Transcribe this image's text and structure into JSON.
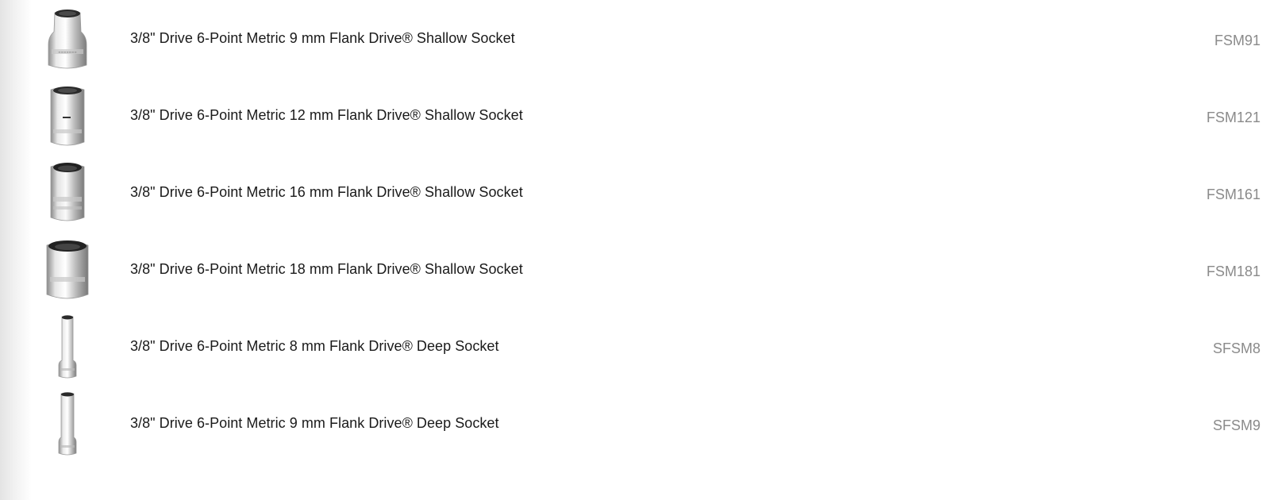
{
  "products": [
    {
      "name": "3/8\" Drive 6-Point Metric 9 mm Flank Drive® Shallow Socket",
      "sku": "FSM91",
      "image": "shallow-socket-icon"
    },
    {
      "name": "3/8\" Drive 6-Point Metric 12 mm Flank Drive® Shallow Socket",
      "sku": "FSM121",
      "image": "shallow-socket-icon"
    },
    {
      "name": "3/8\" Drive 6-Point Metric 16 mm Flank Drive® Shallow Socket",
      "sku": "FSM161",
      "image": "shallow-socket-icon"
    },
    {
      "name": "3/8\" Drive 6-Point Metric 18 mm Flank Drive® Shallow Socket",
      "sku": "FSM181",
      "image": "shallow-socket-icon"
    },
    {
      "name": "3/8\" Drive 6-Point Metric 8 mm Flank Drive® Deep Socket",
      "sku": "SFSM8",
      "image": "deep-socket-icon"
    },
    {
      "name": "3/8\" Drive 6-Point Metric 9 mm Flank Drive® Deep Socket",
      "sku": "SFSM9",
      "image": "deep-socket-icon"
    }
  ]
}
